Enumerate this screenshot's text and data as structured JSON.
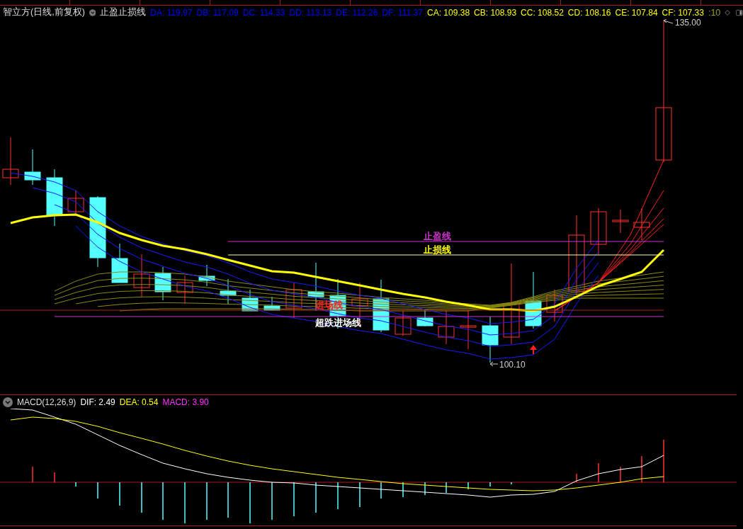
{
  "header": {
    "security": "智立方(日线,前复权)",
    "indicator": "止盈止损线",
    "period": ":10",
    "values": [
      {
        "label": "DA: 119.97",
        "color": "#0000ff"
      },
      {
        "label": "DB: 117.09",
        "color": "#0000ff"
      },
      {
        "label": "DC: 114.33",
        "color": "#0000ff"
      },
      {
        "label": "DD: 113.13",
        "color": "#0000ff"
      },
      {
        "label": "DE: 112.26",
        "color": "#0000ff"
      },
      {
        "label": "DF: 111.37",
        "color": "#0000ff"
      },
      {
        "label": "CA: 109.38",
        "color": "#ffff00"
      },
      {
        "label": "CB: 108.93",
        "color": "#ffff00"
      },
      {
        "label": "CC: 108.52",
        "color": "#ffff00"
      },
      {
        "label": "CD: 108.16",
        "color": "#ffff00"
      },
      {
        "label": "CE: 107.84",
        "color": "#ffff00"
      },
      {
        "label": "CF: 107.33",
        "color": "#ffff00"
      }
    ]
  },
  "price_chart": {
    "high_label": "135.00",
    "low_label": "100.10",
    "lines": [
      {
        "label": "止盈线",
        "color": "#cc33cc"
      },
      {
        "label": "止损线",
        "color": "#ffff00"
      },
      {
        "label": "进场线",
        "color": "#ff2020"
      },
      {
        "label": "超跌进场线",
        "color": "#ffffff"
      }
    ]
  },
  "macd": {
    "name": "MACD(12,26,9)",
    "values": [
      {
        "label": "DIF: 2.49",
        "color": "#ffffff"
      },
      {
        "label": "DEA: 0.54",
        "color": "#ffff00"
      },
      {
        "label": "MACD: 3.90",
        "color": "#ff33ff"
      }
    ]
  }
}
